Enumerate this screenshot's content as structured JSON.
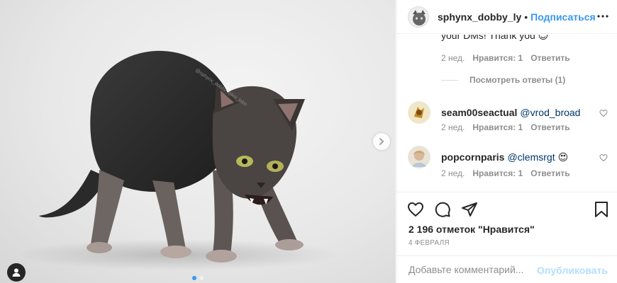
{
  "media": {
    "watermark": "@sphynx_dobby_lykoi_lobo",
    "carousel": {
      "total": 2,
      "active": 0
    }
  },
  "header": {
    "username": "sphynx_dobby_ly",
    "separator": "•",
    "follow_label": "Подписаться"
  },
  "comments": {
    "clipped_text": "your DMs! Thank you 😊",
    "first_meta": {
      "time": "2 нед.",
      "likes": "Нравится: 1",
      "reply": "Ответить"
    },
    "view_replies": "Посмотреть ответы (1)",
    "items": [
      {
        "username": "seam00seactual",
        "mention": "@vrod_broad",
        "emoji": "",
        "time": "2 нед.",
        "likes": "Нравится: 1",
        "reply": "Ответить"
      },
      {
        "username": "popcornparis",
        "mention": "@clemsrgt",
        "emoji": "😍",
        "time": "2 нед.",
        "likes": "Нравится: 1",
        "reply": "Ответить"
      }
    ]
  },
  "actions": {
    "likes_text": "2 196 отметок \"Нравится\"",
    "date": "4 ФЕВРАЛЯ"
  },
  "add_comment": {
    "placeholder": "Добавьте комментарий...",
    "post_label": "Опубликовать"
  }
}
